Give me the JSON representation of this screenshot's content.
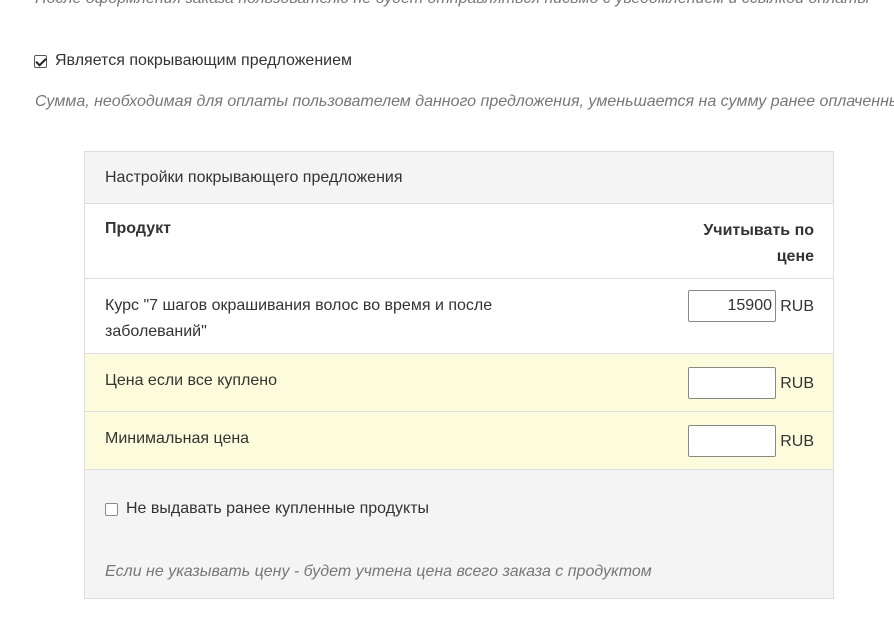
{
  "top_note": "После оформления заказа пользователю не будет отправляться письмо с уведомлением и ссылкой оплаты",
  "cover_offer": {
    "label": "Является покрывающим предложением",
    "checked": true
  },
  "sum_note": "Сумма, необходимая для оплаты пользователем данного предложения, уменьшается на сумму ранее оплаченных",
  "panel": {
    "title": "Настройки покрывающего предложения",
    "columns": {
      "product": "Продукт",
      "price": "Учитывать по цене"
    },
    "rows": [
      {
        "label": "Курс \"7 шагов окрашивания волос во время и после заболеваний\"",
        "value": "15900",
        "currency": "RUB"
      },
      {
        "label": "Цена если все куплено",
        "value": "",
        "currency": "RUB"
      },
      {
        "label": "Минимальная цена",
        "value": "",
        "currency": "RUB"
      }
    ],
    "no_give": {
      "label": "Не выдавать ранее купленные продукты",
      "checked": false
    },
    "price_note": "Если не указывать цену - будет учтена цена всего заказа с продуктом"
  },
  "colors": {
    "highlight_row": "#fcfcdc",
    "panel_bg": "#f4f4f4",
    "muted_text": "#777777"
  }
}
